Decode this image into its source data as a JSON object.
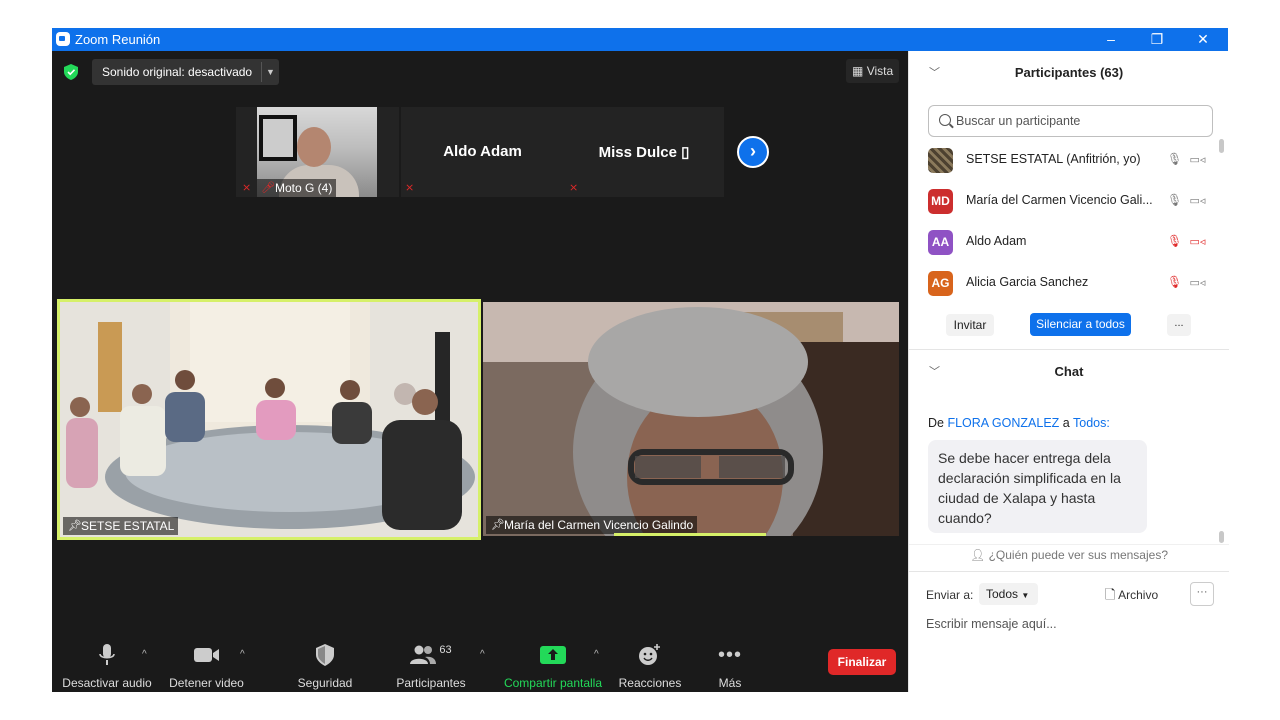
{
  "window": {
    "title": "Zoom Reunión",
    "controls": [
      "–",
      "❐",
      "✕"
    ]
  },
  "meeting": {
    "sound_label": "Sonido original: desactivado",
    "view_label": "Vista",
    "thumbnails": [
      {
        "label": "Moto G (4)"
      },
      {
        "label": "Aldo Adam"
      },
      {
        "label": "Miss  Dulce ▯"
      }
    ],
    "tiles": [
      {
        "label": "SETSE ESTATAL"
      },
      {
        "label": "María del Carmen Vicencio Galindo"
      }
    ]
  },
  "toolbar": {
    "audio_label": "Desactivar audio",
    "video_label": "Detener video",
    "security_label": "Seguridad",
    "participants_label": "Participantes",
    "participants_count": "63",
    "share_label": "Compartir pantalla",
    "reactions_label": "Reacciones",
    "more_label": "Más",
    "end_label": "Finalizar"
  },
  "participants": {
    "header": "Participantes (63)",
    "search_placeholder": "Buscar un participante",
    "list": [
      {
        "initials": "",
        "name": "SETSE ESTATAL (Anfitrión, yo)",
        "color": "#6a5a40",
        "muted": false,
        "video_off": false
      },
      {
        "initials": "MD",
        "name": "María del Carmen Vicencio Gali...",
        "color": "#cc2e2e",
        "muted": false,
        "video_off": false
      },
      {
        "initials": "AA",
        "name": "Aldo Adam",
        "color": "#8f52c4",
        "muted": true,
        "video_off": true
      },
      {
        "initials": "AG",
        "name": "Alicia Garcia Sanchez",
        "color": "#d8641c",
        "muted": true,
        "video_off": false
      }
    ],
    "invite_label": "Invitar",
    "mute_all_label": "Silenciar a todos",
    "more_label": "..."
  },
  "chat": {
    "header": "Chat",
    "from_prefix": "De",
    "from_name": "FLORA GONZALEZ",
    "to_word": "a",
    "to_name": "Todos:",
    "message": "Se debe hacer entrega dela declaración simplificada en la ciudad de Xalapa y hasta cuando?",
    "who_can_see": "¿Quién puede ver sus mensajes?",
    "send_to_label": "Enviar a:",
    "send_to_value": "Todos",
    "file_label": "Archivo",
    "dots_label": "···",
    "input_placeholder": "Escribir mensaje aquí..."
  },
  "colors": {
    "zoom_blue": "#0e71eb",
    "end_red": "#e02828",
    "speaker_highlight": "#d6f069",
    "share_green": "#23d959"
  }
}
